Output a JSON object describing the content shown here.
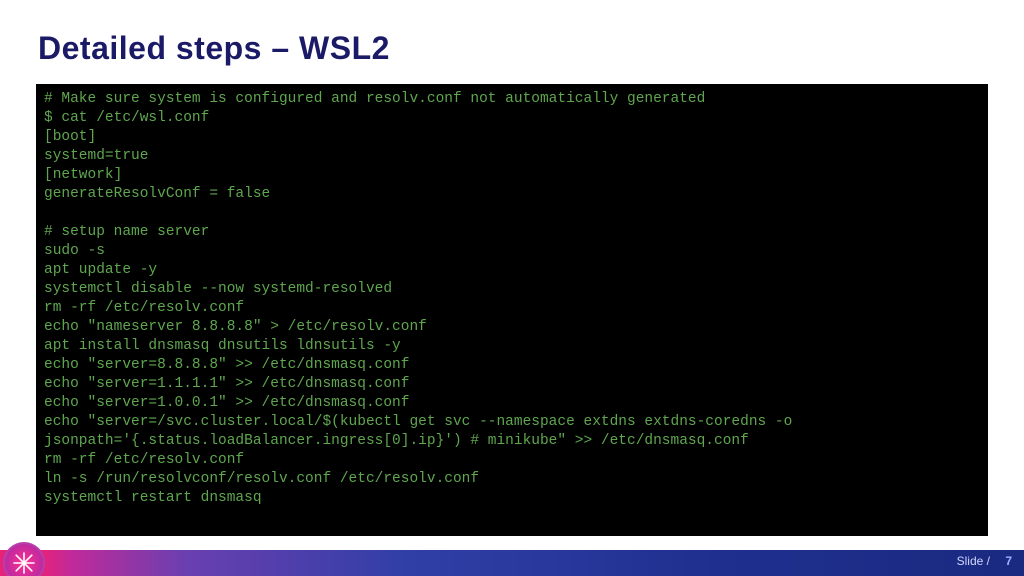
{
  "title": "Detailed steps – WSL2",
  "terminal": {
    "lines": [
      "# Make sure system is configured and resolv.conf not automatically generated",
      "$ cat /etc/wsl.conf",
      "[boot]",
      "systemd=true",
      "[network]",
      "generateResolvConf = false",
      "",
      "# setup name server",
      "sudo -s",
      "apt update -y",
      "systemctl disable --now systemd-resolved",
      "rm -rf /etc/resolv.conf",
      "echo \"nameserver 8.8.8.8\" > /etc/resolv.conf",
      "apt install dnsmasq dnsutils ldnsutils -y",
      "echo \"server=8.8.8.8\" >> /etc/dnsmasq.conf",
      "echo \"server=1.1.1.1\" >> /etc/dnsmasq.conf",
      "echo \"server=1.0.0.1\" >> /etc/dnsmasq.conf",
      "echo \"server=/svc.cluster.local/$(kubectl get svc --namespace extdns extdns-coredns -o",
      "jsonpath='{.status.loadBalancer.ingress[0].ip}') # minikube\" >> /etc/dnsmasq.conf",
      "rm -rf /etc/resolv.conf",
      "ln -s /run/resolvconf/resolv.conf /etc/resolv.conf",
      "systemctl restart dnsmasq"
    ]
  },
  "footer": {
    "label": "Slide /",
    "page": "7"
  }
}
